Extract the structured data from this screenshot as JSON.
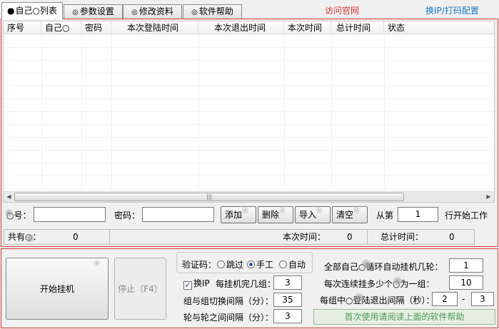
{
  "tabs": [
    {
      "mark": "●",
      "label": "自己○列表",
      "active": true
    },
    {
      "mark": "◎",
      "label": "参数设置",
      "active": false
    },
    {
      "mark": "◎",
      "label": "修改资料",
      "active": false
    },
    {
      "mark": "◎",
      "label": "软件帮助",
      "active": false
    }
  ],
  "top_links": {
    "visit_site": "访问官网",
    "switch_ip": "换IP/打码配置"
  },
  "colors": {
    "visit_site": "#e03030",
    "switch_ip": "#1a79c2",
    "panel_border": "#d23a3a",
    "help_text": "#4b9a55"
  },
  "list": {
    "columns": [
      "序号",
      "自己○",
      "密码",
      "本次登陆时间",
      "本次退出时间",
      "本次时间",
      "总计时间",
      "状态"
    ],
    "rows": []
  },
  "scrollbar": {
    "left_arrow": "◀",
    "right_arrow": "▶",
    "thumb_grip": "|||"
  },
  "form": {
    "account_label": "○号：",
    "account_value": "",
    "password_label": "密码：",
    "password_value": "",
    "add_button": "添加",
    "delete_button": "删除",
    "import_button": "导入",
    "clear_button": "清空",
    "from_label": "从第",
    "from_value": "1",
    "start_label": "行开始工作"
  },
  "status": {
    "total_label": "共有○：",
    "total_value": "0",
    "session_time_label": "本次时间：",
    "session_time_value": "0",
    "total_time_label": "总计时间：",
    "total_time_value": "0"
  },
  "controls": {
    "start_button": "开始挂机",
    "stop_button": "停止（F4）",
    "captcha_label": "验证码：",
    "captcha_options": [
      "跳过",
      "手工",
      "自动"
    ],
    "captcha_selected": "手工",
    "switch_ip_label": "换IP",
    "switch_ip_checked": true,
    "per_group_label": "每挂机完几组：",
    "per_group_value": "3",
    "group_interval_label": "组与组切换间隔（分）：",
    "group_interval_value": "35",
    "round_interval_label": "轮与轮之间间隔（分）：",
    "round_interval_value": "3",
    "loop_rounds_label": "全部自己○循环自动挂机几轮：",
    "loop_rounds_value": "1",
    "accounts_per_group_label": "每次连续挂多少个○为一组：",
    "accounts_per_group_value": "10",
    "login_logout_interval_label": "每组中○登陆退出间隔（秒）：",
    "login_logout_min": "2",
    "range_separator": "-",
    "login_logout_max": "3",
    "help_hint": "首次使用请阅读上面的软件帮助"
  }
}
